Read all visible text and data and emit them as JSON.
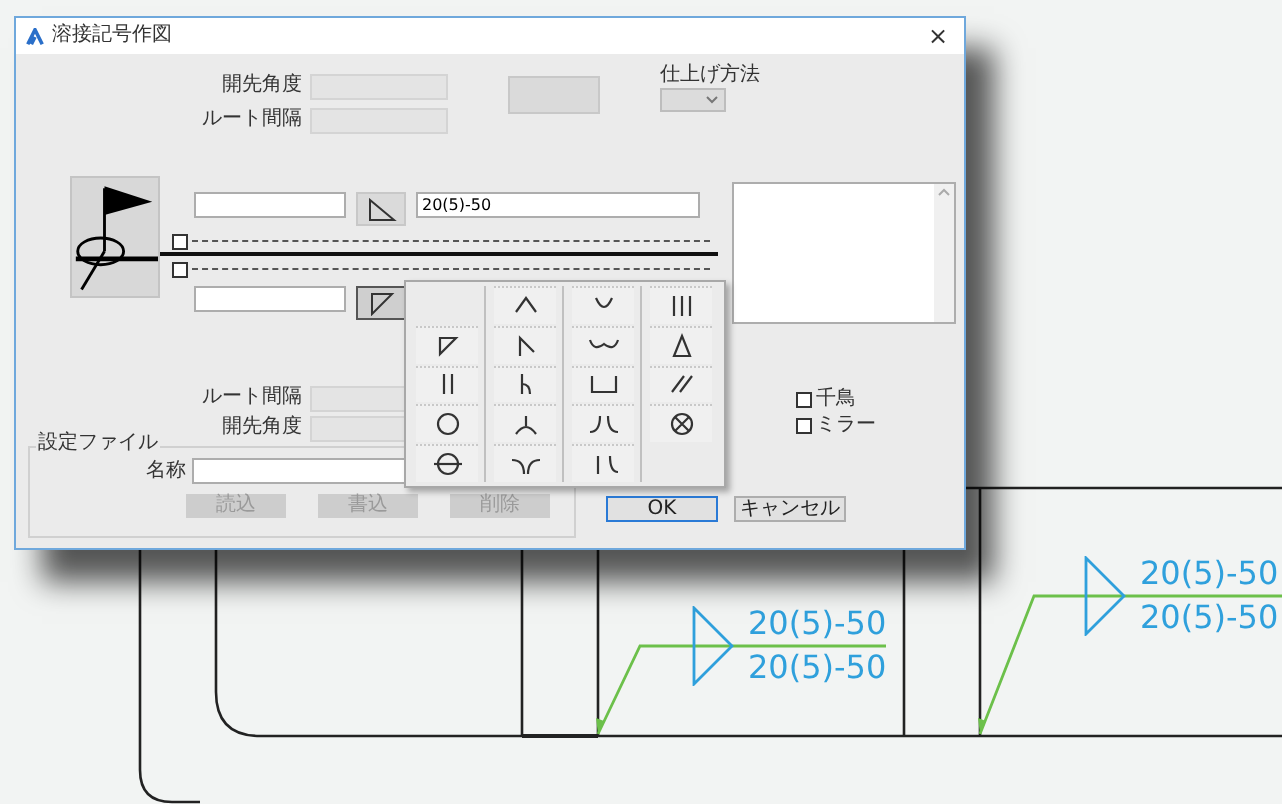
{
  "window": {
    "title": "溶接記号作図",
    "close": "×"
  },
  "groove_angle_top": {
    "label": "開先角度"
  },
  "root_gap_top": {
    "label": "ルート間隔"
  },
  "finish_method": {
    "label": "仕上げ方法"
  },
  "upper_row": {
    "value": "20(5)-50"
  },
  "reference_checkboxes": [
    {
      "checked": false
    },
    {
      "checked": false
    }
  ],
  "lower_row": {
    "menu_open": true
  },
  "root_gap_bottom": {
    "label": "ルート間隔"
  },
  "groove_angle_bottom": {
    "label": "開先角度"
  },
  "options": [
    {
      "label": "千鳥",
      "checked": false
    },
    {
      "label": "ミラー",
      "checked": false
    }
  ],
  "settings_file": {
    "title": "設定ファイル",
    "name_label": "名称",
    "buttons": [
      {
        "label": "読込",
        "disabled": true
      },
      {
        "label": "書込",
        "disabled": true
      },
      {
        "label": "削除",
        "disabled": true
      }
    ]
  },
  "buttons": [
    {
      "label": "OK",
      "default": true
    },
    {
      "label": "キャンセル",
      "default": false
    }
  ],
  "annotations": [
    {
      "above": "20(5)-50",
      "below": "20(5)-50"
    },
    {
      "above": "20(5)-50",
      "below": "20(5)-50"
    }
  ]
}
